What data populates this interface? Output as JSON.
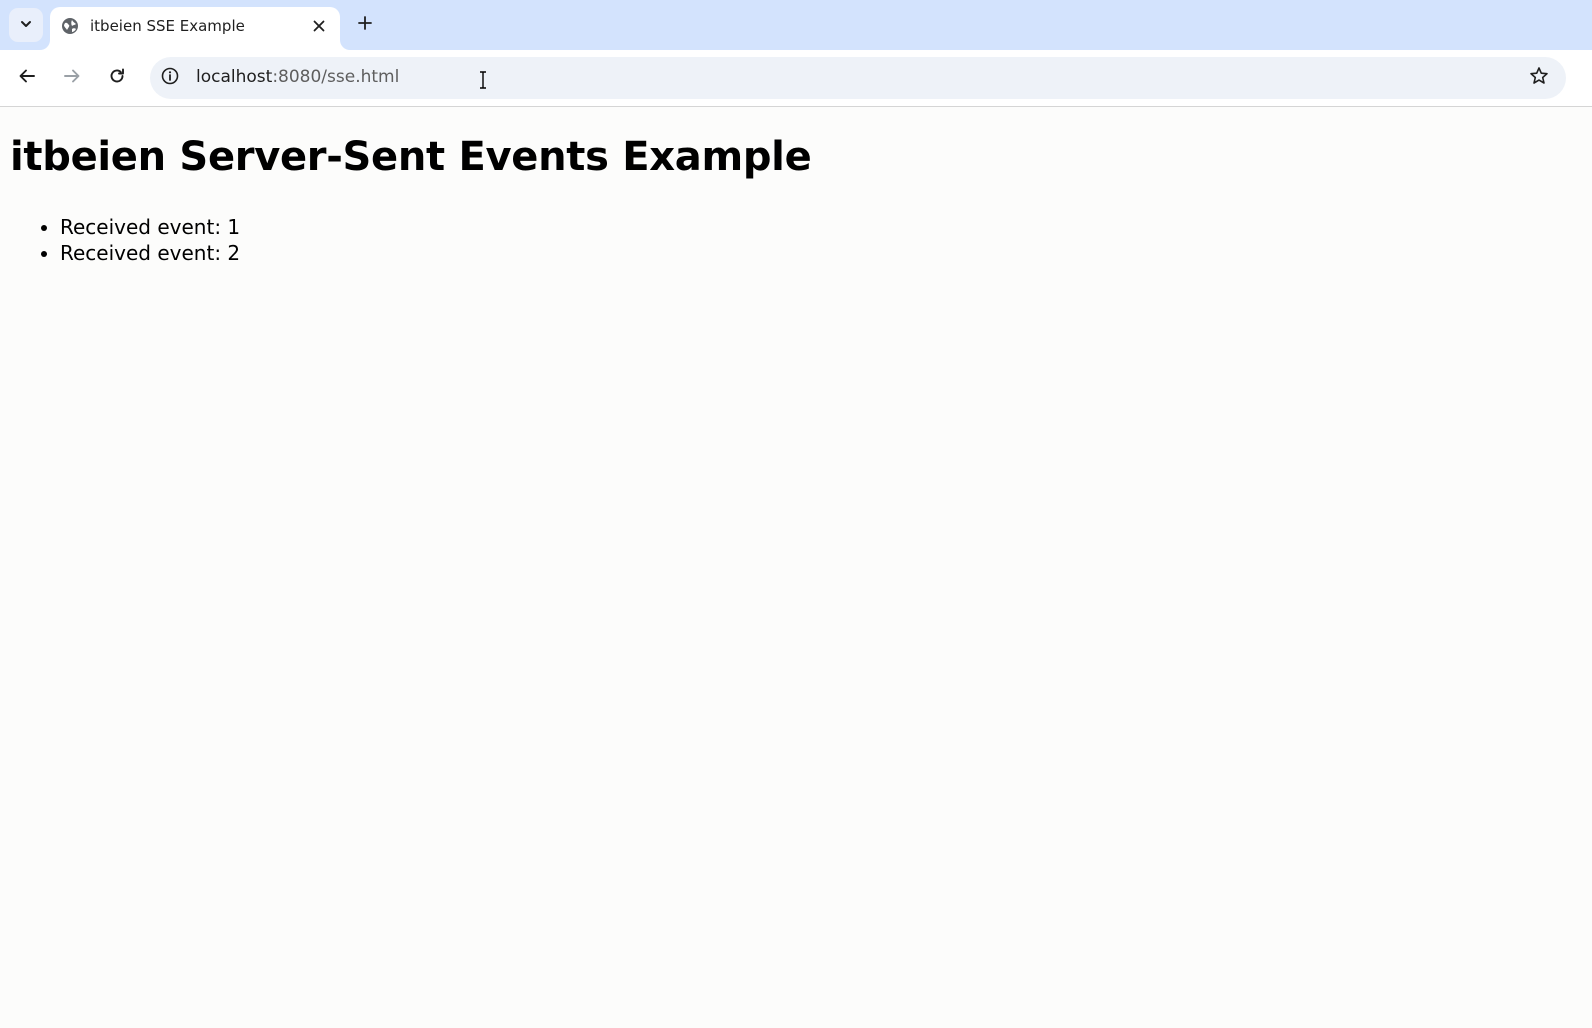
{
  "browser": {
    "tab": {
      "title": "itbeien SSE Example"
    },
    "address_bar": {
      "host": "localhost",
      "rest": ":8080/sse.html"
    }
  },
  "page": {
    "title": "itbeien Server-Sent Events Example",
    "events": [
      "Received event: 1",
      "Received event: 2"
    ]
  },
  "colors": {
    "tabstrip_bg": "#d3e3fd",
    "omnibox_bg": "#eef2f8",
    "page_bg": "#fcfcfb"
  },
  "icons": {
    "tab_search": "chevron-down-icon",
    "favicon": "globe-icon",
    "tab_close": "close-icon",
    "new_tab": "plus-icon",
    "back": "arrow-left-icon",
    "forward": "arrow-right-icon",
    "reload": "reload-icon",
    "site_info": "info-icon",
    "bookmark": "star-icon",
    "cursor": "text-cursor-icon"
  }
}
